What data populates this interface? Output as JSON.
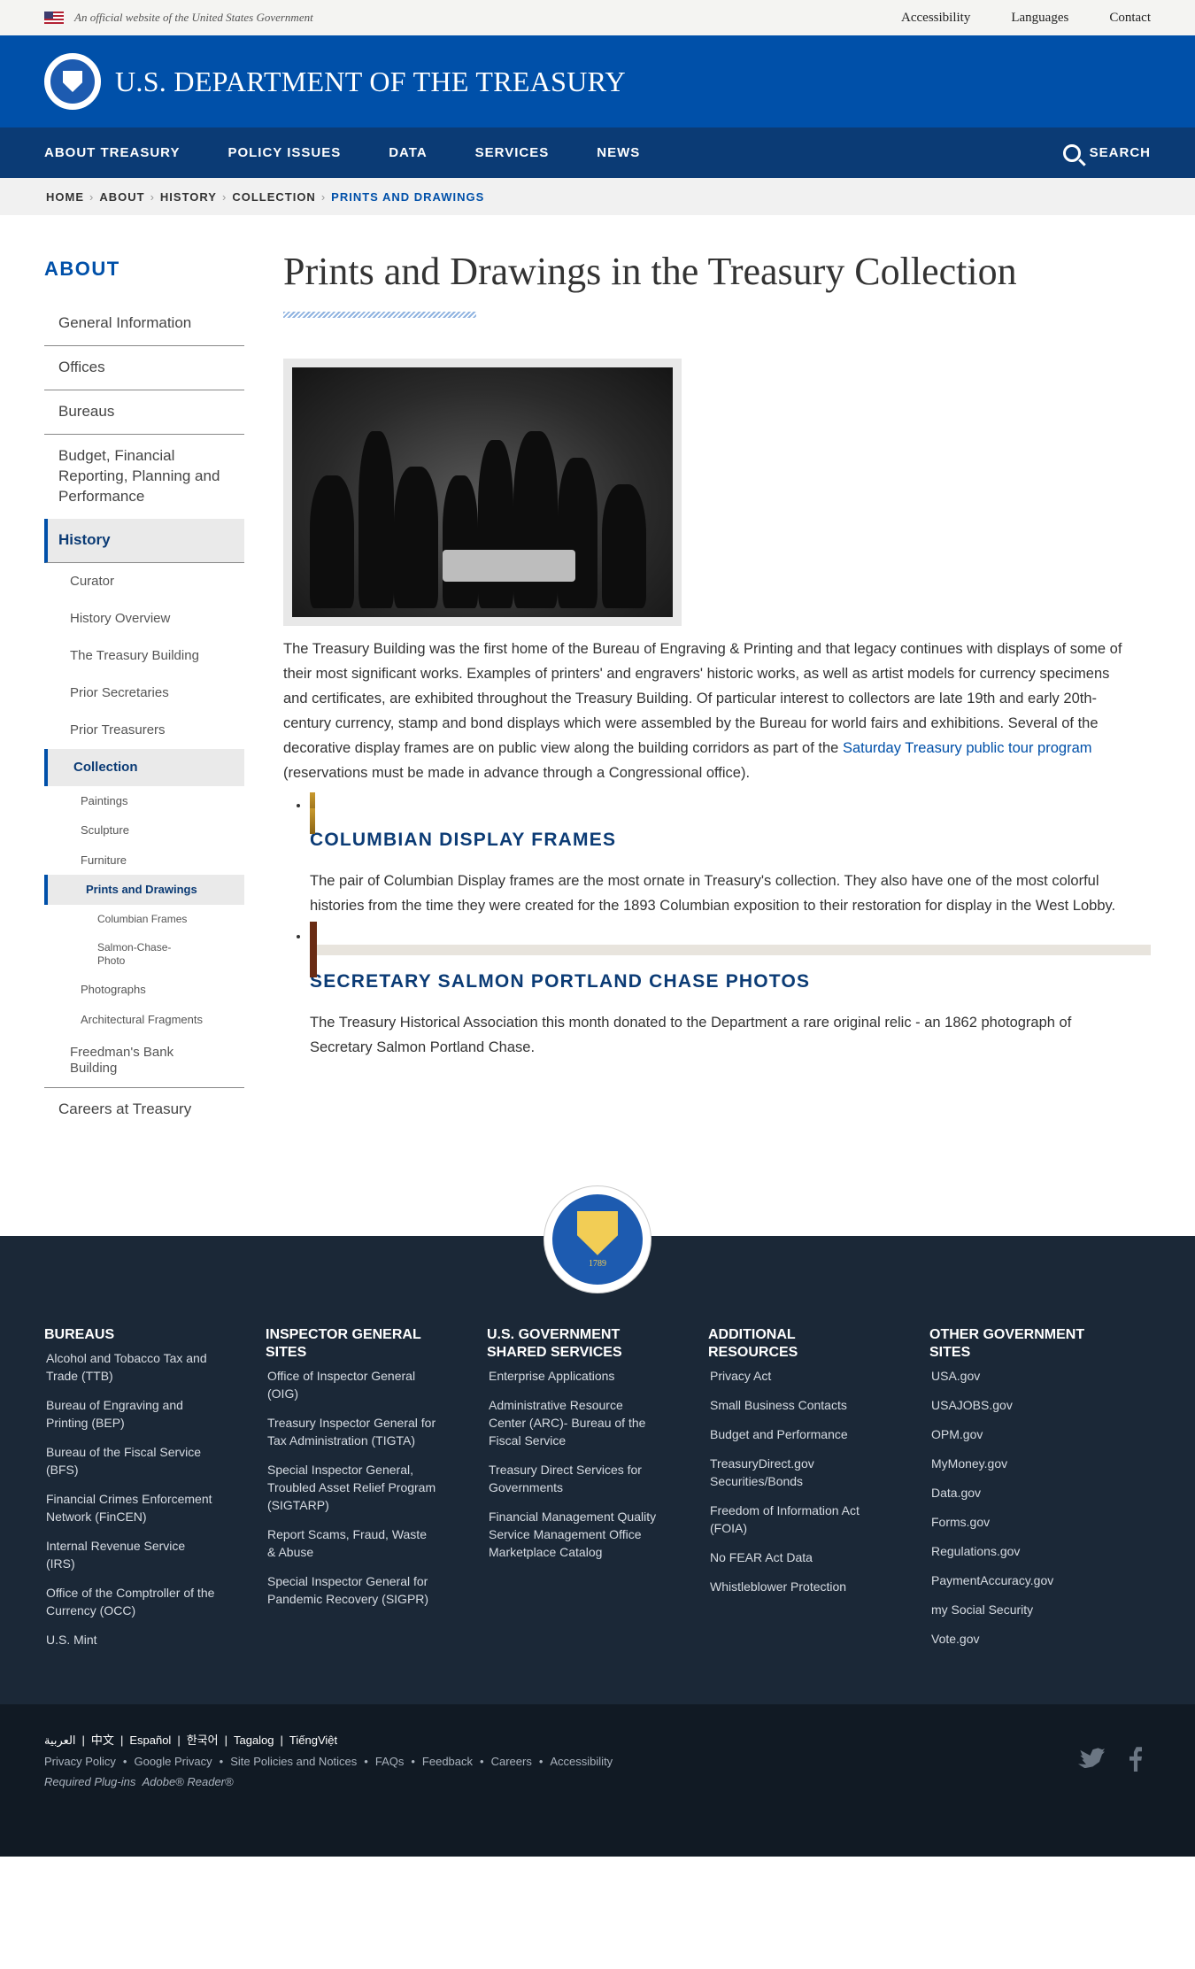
{
  "banner": {
    "gov_text": "An official website of the United States Government",
    "utility": [
      "Accessibility",
      "Languages",
      "Contact"
    ]
  },
  "header": {
    "title": "U.S. DEPARTMENT OF THE TREASURY"
  },
  "nav": {
    "items": [
      "ABOUT TREASURY",
      "POLICY ISSUES",
      "DATA",
      "SERVICES",
      "NEWS"
    ],
    "search_label": "SEARCH"
  },
  "breadcrumb": [
    "HOME",
    "ABOUT",
    "HISTORY",
    "COLLECTION",
    "PRINTS AND DRAWINGS"
  ],
  "sidebar": {
    "title": "ABOUT",
    "l1_top": [
      "General Information",
      "Offices",
      "Bureaus",
      "Budget, Financial Reporting, Planning and Performance"
    ],
    "history": "History",
    "history_items": [
      "Curator",
      "History Overview",
      "The Treasury Building",
      "Prior Secretaries",
      "Prior Treasurers"
    ],
    "collection": "Collection",
    "collection_items": [
      "Paintings",
      "Sculpture",
      "Furniture"
    ],
    "prints": "Prints and Drawings",
    "prints_items": [
      "Columbian Frames",
      "Salmon-Chase-Photo"
    ],
    "collection_items_after": [
      "Photographs",
      "Architectural Fragments"
    ],
    "freedmans": "Freedman's Bank Building",
    "careers": "Careers at Treasury"
  },
  "main": {
    "title": "Prints and Drawings in the Treasury Collection",
    "intro": "The Treasury Building was the first home of the Bureau of Engraving & Printing and that legacy continues with displays of some of their most significant works. Examples of printers' and engravers' historic works, as well as artist models for currency specimens and certificates, are exhibited throughout the Treasury Building. Of particular interest to collectors are late 19th and early 20th-century currency, stamp and bond displays which were assembled by the Bureau for world fairs and exhibitions. Several of the decorative display frames are on public view along the building corridors as part of the ",
    "intro_link": "Saturday Treasury public tour program",
    "intro_end": " (reservations must be made in advance through a Congressional office).",
    "items": [
      {
        "title": "COLUMBIAN DISPLAY FRAMES",
        "desc": "The pair of Columbian Display frames are the most ornate in Treasury's collection. They also have one of the most colorful histories from the time they were created for the 1893 Columbian exposition to their restoration for display in the West Lobby."
      },
      {
        "title": "SECRETARY SALMON PORTLAND CHASE PHOTOS",
        "desc": "The Treasury Historical Association this month donated to the Department a rare original relic - an 1862 photograph of Secretary Salmon Portland Chase."
      }
    ]
  },
  "footer": {
    "seal_year": "1789",
    "columns": [
      {
        "title": "BUREAUS",
        "links": [
          "Alcohol and Tobacco Tax and Trade (TTB)",
          "Bureau of Engraving and Printing (BEP)",
          "Bureau of the Fiscal Service (BFS)",
          "Financial Crimes Enforcement Network (FinCEN)",
          "Internal Revenue Service (IRS)",
          "Office of the Comptroller of the Currency (OCC)",
          "U.S. Mint"
        ]
      },
      {
        "title": "INSPECTOR GENERAL SITES",
        "links": [
          "Office of Inspector General (OIG)",
          "Treasury Inspector General for Tax Administration (TIGTA)",
          "Special Inspector General, Troubled Asset Relief Program (SIGTARP)",
          "Report Scams, Fraud, Waste & Abuse",
          "Special Inspector General for Pandemic Recovery (SIGPR)"
        ]
      },
      {
        "title": "U.S. GOVERNMENT SHARED SERVICES",
        "links": [
          "Enterprise Applications",
          "Administrative Resource Center (ARC)- Bureau of the Fiscal Service",
          "Treasury Direct Services for Governments",
          "Financial Management Quality Service Management Office Marketplace Catalog"
        ]
      },
      {
        "title": "ADDITIONAL RESOURCES",
        "links": [
          "Privacy Act",
          "Small Business Contacts",
          "Budget and Performance",
          "TreasuryDirect.gov Securities/Bonds",
          "Freedom of Information Act (FOIA)",
          "No FEAR Act Data",
          "Whistleblower Protection"
        ]
      },
      {
        "title": "OTHER GOVERNMENT SITES",
        "links": [
          "USA.gov",
          "USAJOBS.gov",
          "OPM.gov",
          "MyMoney.gov",
          "Data.gov",
          "Forms.gov",
          "Regulations.gov",
          "PaymentAccuracy.gov",
          "my Social Security",
          "Vote.gov"
        ]
      }
    ],
    "languages": [
      "العربية",
      "中文",
      "Español",
      "한국어",
      "Tagalog",
      "TiếngViệt"
    ],
    "sublinks": [
      "Privacy Policy",
      "Google Privacy",
      "Site Policies and Notices",
      "FAQs",
      "Feedback",
      "Careers",
      "Accessibility"
    ],
    "plugins_label": "Required Plug-ins",
    "plugins_value": "Adobe® Reader®"
  }
}
